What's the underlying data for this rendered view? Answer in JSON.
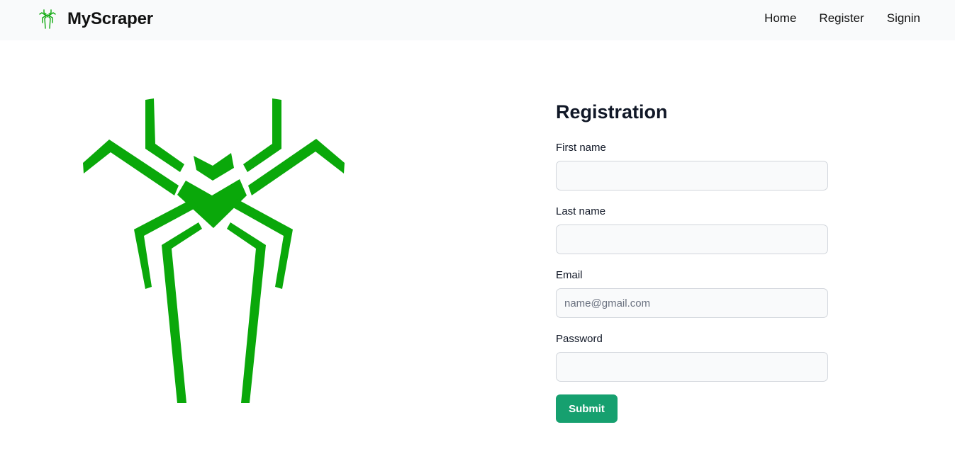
{
  "navbar": {
    "brand_name": "MyScraper",
    "brand_icon": "spider-logo-icon",
    "links": [
      {
        "label": "Home"
      },
      {
        "label": "Register"
      },
      {
        "label": "Signin"
      }
    ]
  },
  "hero": {
    "icon": "spider-emblem",
    "color": "#0aa80a"
  },
  "form": {
    "title": "Registration",
    "fields": [
      {
        "label": "First name",
        "value": "",
        "placeholder": ""
      },
      {
        "label": "Last name",
        "value": "",
        "placeholder": ""
      },
      {
        "label": "Email",
        "value": "",
        "placeholder": "name@gmail.com"
      },
      {
        "label": "Password",
        "value": "",
        "placeholder": ""
      }
    ],
    "submit_label": "Submit"
  },
  "colors": {
    "accent": "#16a06f",
    "navbar_bg": "#f9fafb",
    "spider_green": "#0aa80a"
  }
}
